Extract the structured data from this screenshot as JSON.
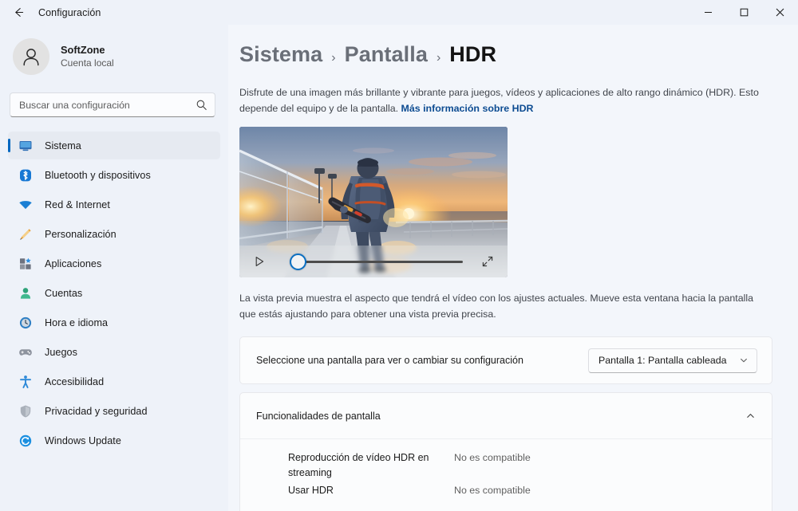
{
  "titlebar": {
    "back_label": "back-arrow",
    "title": "Configuración",
    "minimize": "–",
    "maximize": "□",
    "close": "✕"
  },
  "sidebar": {
    "account": {
      "name": "SoftZone",
      "subtitle": "Cuenta local"
    },
    "search": {
      "placeholder": "Buscar una configuración",
      "value": "",
      "icon": "search-icon"
    },
    "items": [
      {
        "label": "Sistema",
        "icon": "monitor-icon",
        "selected": true
      },
      {
        "label": "Bluetooth y dispositivos",
        "icon": "bluetooth-icon",
        "selected": false
      },
      {
        "label": "Red & Internet",
        "icon": "wifi-icon",
        "selected": false
      },
      {
        "label": "Personalización",
        "icon": "brush-icon",
        "selected": false
      },
      {
        "label": "Aplicaciones",
        "icon": "apps-icon",
        "selected": false
      },
      {
        "label": "Cuentas",
        "icon": "person-icon",
        "selected": false
      },
      {
        "label": "Hora e idioma",
        "icon": "clock-icon",
        "selected": false
      },
      {
        "label": "Juegos",
        "icon": "gamepad-icon",
        "selected": false
      },
      {
        "label": "Accesibilidad",
        "icon": "accessibility-icon",
        "selected": false
      },
      {
        "label": "Privacidad y seguridad",
        "icon": "shield-icon",
        "selected": false
      },
      {
        "label": "Windows Update",
        "icon": "update-icon",
        "selected": false
      }
    ]
  },
  "main": {
    "breadcrumb": {
      "items": [
        "Sistema",
        "Pantalla",
        "HDR"
      ],
      "separator": "›"
    },
    "intro": {
      "text": "Disfrute de una imagen más brillante y vibrante para juegos, vídeos y aplicaciones de alto rango dinámico (HDR). Esto depende del equipo y de la pantalla. ",
      "link": "Más información sobre HDR"
    },
    "video": {
      "play_icon": "play-icon",
      "fullscreen_icon": "fullscreen-icon",
      "seek_position_percent": 4,
      "alt": "Persona con tabla de snowboard caminando por un muelle al atardecer"
    },
    "preview_note": "La vista previa muestra el aspecto que tendrá el vídeo con los ajustes actuales. Mueve esta ventana hacia la pantalla que estás ajustando para obtener una vista previa precisa.",
    "display_select": {
      "label": "Seleccione una pantalla para ver o cambiar su configuración",
      "value": "Pantalla 1: Pantalla cableada",
      "chevron": "chevron-down-icon"
    },
    "capabilities": {
      "title": "Funcionalidades de pantalla",
      "expanded": true,
      "chevron": "chevron-up-icon",
      "rows": [
        {
          "name": "Reproducción de vídeo HDR en streaming",
          "value": "No es compatible"
        },
        {
          "name": "Usar HDR",
          "value": "No es compatible"
        }
      ]
    }
  },
  "colors": {
    "accent": "#0067c0",
    "link": "#0d4c92",
    "sidebar_bg": "#eef2f9",
    "main_bg": "#f3f6fb",
    "card_bg": "#fbfcfd"
  }
}
